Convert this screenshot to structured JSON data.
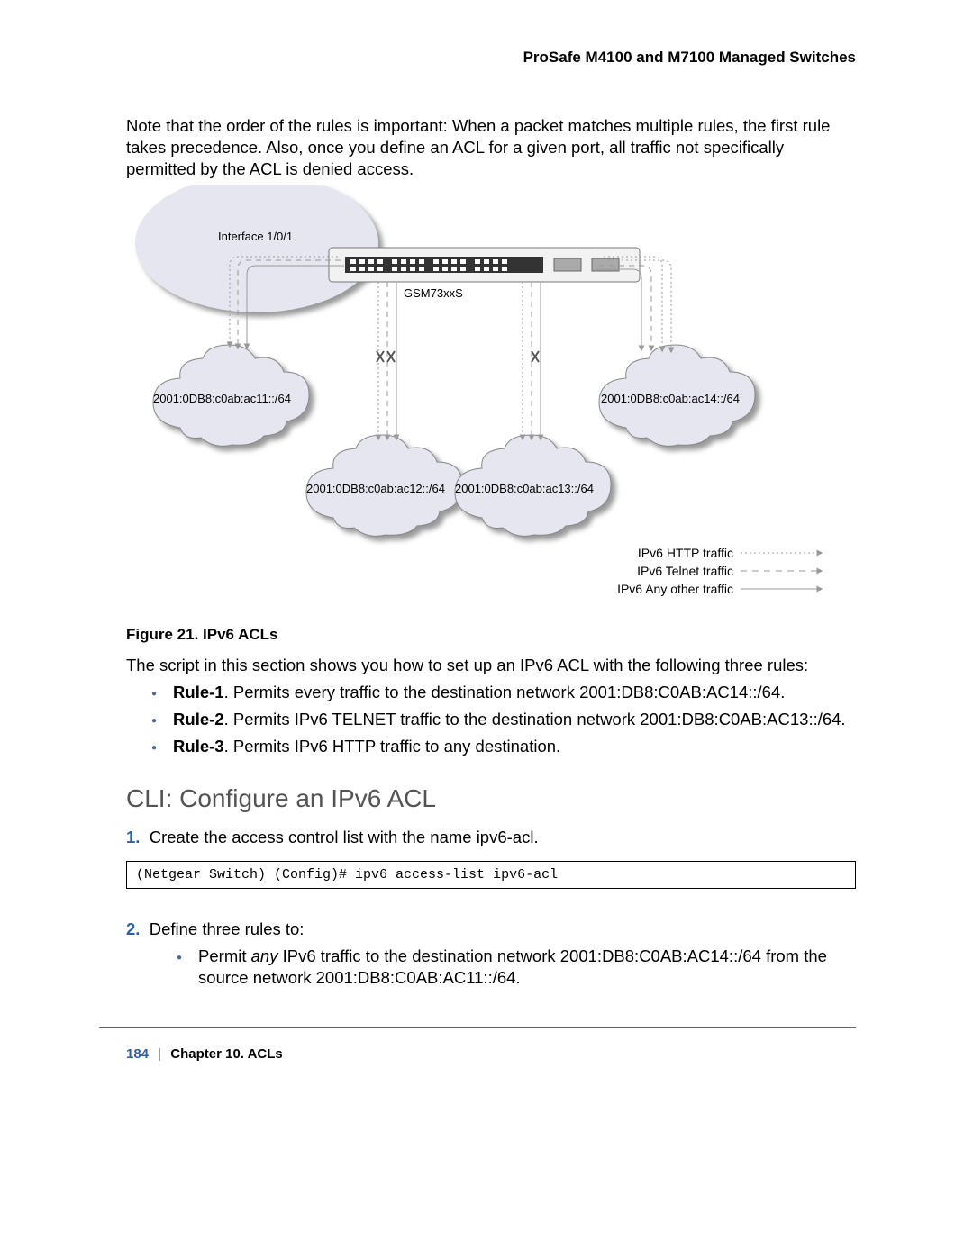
{
  "header": {
    "title": "ProSafe M4100 and M7100 Managed Switches"
  },
  "para1": "Note that the order of the rules is important: When a packet matches multiple rules, the first rule takes precedence. Also, once you define an ACL for a given port, all traffic not specifically permitted by the ACL is denied access.",
  "diagram": {
    "interface_label": "Interface 1/0/1",
    "device_label": "GSM73xxS",
    "cloud1": "2001:0DB8:c0ab:ac11::/64",
    "cloud2": "2001:0DB8:c0ab:ac12::/64",
    "cloud3": "2001:0DB8:c0ab:ac13::/64",
    "cloud4": "2001:0DB8:c0ab:ac14::/64",
    "legend": {
      "http": "IPv6 HTTP traffic",
      "telnet": "IPv6 Telnet traffic",
      "other": "IPv6 Any other traffic"
    }
  },
  "caption": "Figure 21. IPv6 ACLs",
  "para2": "The script in this section shows you how to set up an IPv6 ACL with the following three rules:",
  "rules": [
    {
      "name": "Rule-1",
      "text": ". Permits every traffic to the destination network 2001:DB8:C0AB:AC14::/64."
    },
    {
      "name": "Rule-2",
      "text": ". Permits IPv6 TELNET traffic to the destination network 2001:DB8:C0AB:AC13::/64."
    },
    {
      "name": "Rule-3",
      "text": ". Permits IPv6 HTTP traffic to any destination."
    }
  ],
  "h2": "CLI: Configure an IPv6 ACL",
  "steps": {
    "s1_num": "1.",
    "s1_text": "Create the access control list with the name ipv6-acl.",
    "code": "(Netgear Switch) (Config)# ipv6 access-list ipv6-acl",
    "s2_num": "2.",
    "s2_text": "Define three rules to:",
    "sub_a_pre": "Permit ",
    "sub_a_em": "any",
    "sub_a_post": " IPv6 traffic to the destination network 2001:DB8:C0AB:AC14::/64 from the source network 2001:DB8:C0AB:AC11::/64."
  },
  "footer": {
    "page": "184",
    "chapter": "Chapter 10.  ACLs"
  }
}
